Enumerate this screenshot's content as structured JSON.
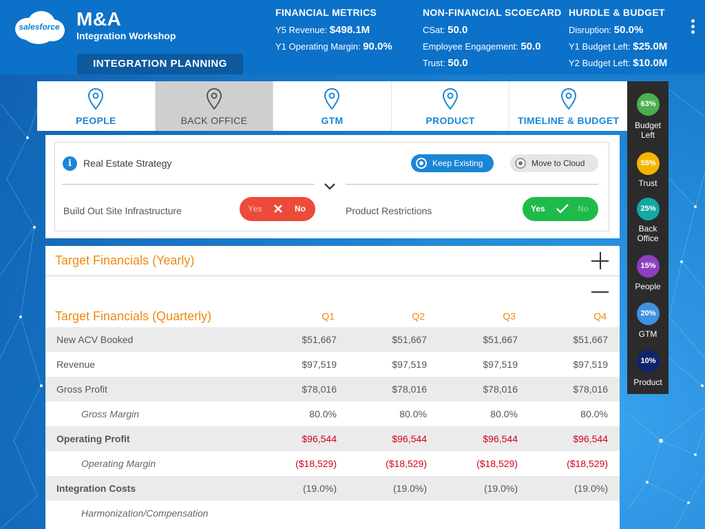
{
  "app": {
    "logo_text": "salesforce",
    "title": "M&A",
    "subtitle": "Integration Workshop",
    "section": "INTEGRATION PLANNING"
  },
  "metrics": {
    "financial": {
      "heading": "FINANCIAL METRICS",
      "rows": [
        {
          "label": "Y5 Revenue:",
          "value": "$498.1M"
        },
        {
          "label": "Y1 Operating Margin:",
          "value": "90.0%"
        }
      ]
    },
    "nonfinancial": {
      "heading": "NON-FINANCIAL SCOECARD",
      "rows": [
        {
          "label": "CSat:",
          "value": "50.0"
        },
        {
          "label": "Employee Engagement:",
          "value": "50.0"
        },
        {
          "label": "Trust:",
          "value": "50.0"
        }
      ]
    },
    "hurdle": {
      "heading": "HURDLE & BUDGET",
      "rows": [
        {
          "label": "Disruption:",
          "value": "50.0%"
        },
        {
          "label": "Y1 Budget Left:",
          "value": "$25.0M"
        },
        {
          "label": "Y2 Budget Left:",
          "value": "$10.0M"
        }
      ]
    }
  },
  "tabs": [
    "PEOPLE",
    "BACK OFFICE",
    "GTM",
    "PRODUCT",
    "TIMELINE & BUDGET"
  ],
  "active_tab": "BACK OFFICE",
  "strategy": {
    "title": "Real Estate Strategy",
    "option_selected": "Keep Existing",
    "option_other": "Move to Cloud",
    "toggle1": {
      "label": "Build Out Site Infrastructure",
      "yes": "Yes",
      "no": "No",
      "value": "No"
    },
    "toggle2": {
      "label": "Product Restrictions",
      "yes": "Yes",
      "no": "No",
      "value": "Yes"
    }
  },
  "financials": {
    "yearly_title": "Target Financials (Yearly)",
    "quarterly_title": "Target Financials (Quarterly)",
    "quarters": [
      "Q1",
      "Q2",
      "Q3",
      "Q4"
    ],
    "rows": [
      {
        "label": "New ACV Booked",
        "values": [
          "$51,667",
          "$51,667",
          "$51,667",
          "$51,667"
        ]
      },
      {
        "label": "Revenue",
        "values": [
          "$97,519",
          "$97,519",
          "$97,519",
          "$97,519"
        ]
      },
      {
        "label": "Gross Profit",
        "values": [
          "$78,016",
          "$78,016",
          "$78,016",
          "$78,016"
        ]
      },
      {
        "label": "Gross Margin",
        "values": [
          "80.0%",
          "80.0%",
          "80.0%",
          "80.0%"
        ]
      },
      {
        "label": "Operating Profit",
        "values": [
          "$96,544",
          "$96,544",
          "$96,544",
          "$96,544"
        ]
      },
      {
        "label": "Operating Margin",
        "values": [
          "($18,529)",
          "($18,529)",
          "($18,529)",
          "($18,529)"
        ]
      },
      {
        "label": "Integration Costs",
        "values": [
          "(19.0%)",
          "(19.0%)",
          "(19.0%)",
          "(19.0%)"
        ]
      },
      {
        "label": "Harmonization/Compensation",
        "values": []
      }
    ]
  },
  "progress": [
    {
      "pct": "63%",
      "label": "Budget Left",
      "color": "#4caf50"
    },
    {
      "pct": "55%",
      "label": "Trust",
      "color": "#f5b400"
    },
    {
      "pct": "25%",
      "label": "Back Office",
      "color": "#14a8a0"
    },
    {
      "pct": "15%",
      "label": "People",
      "color": "#8e3fc0"
    },
    {
      "pct": "20%",
      "label": "GTM",
      "color": "#3f92e0"
    },
    {
      "pct": "10%",
      "label": "Product",
      "color": "#10246b"
    }
  ],
  "colors": {
    "brand_blue": "#0c71c9",
    "accent_orange": "#ef8a12",
    "negative_red": "#d0021b"
  }
}
